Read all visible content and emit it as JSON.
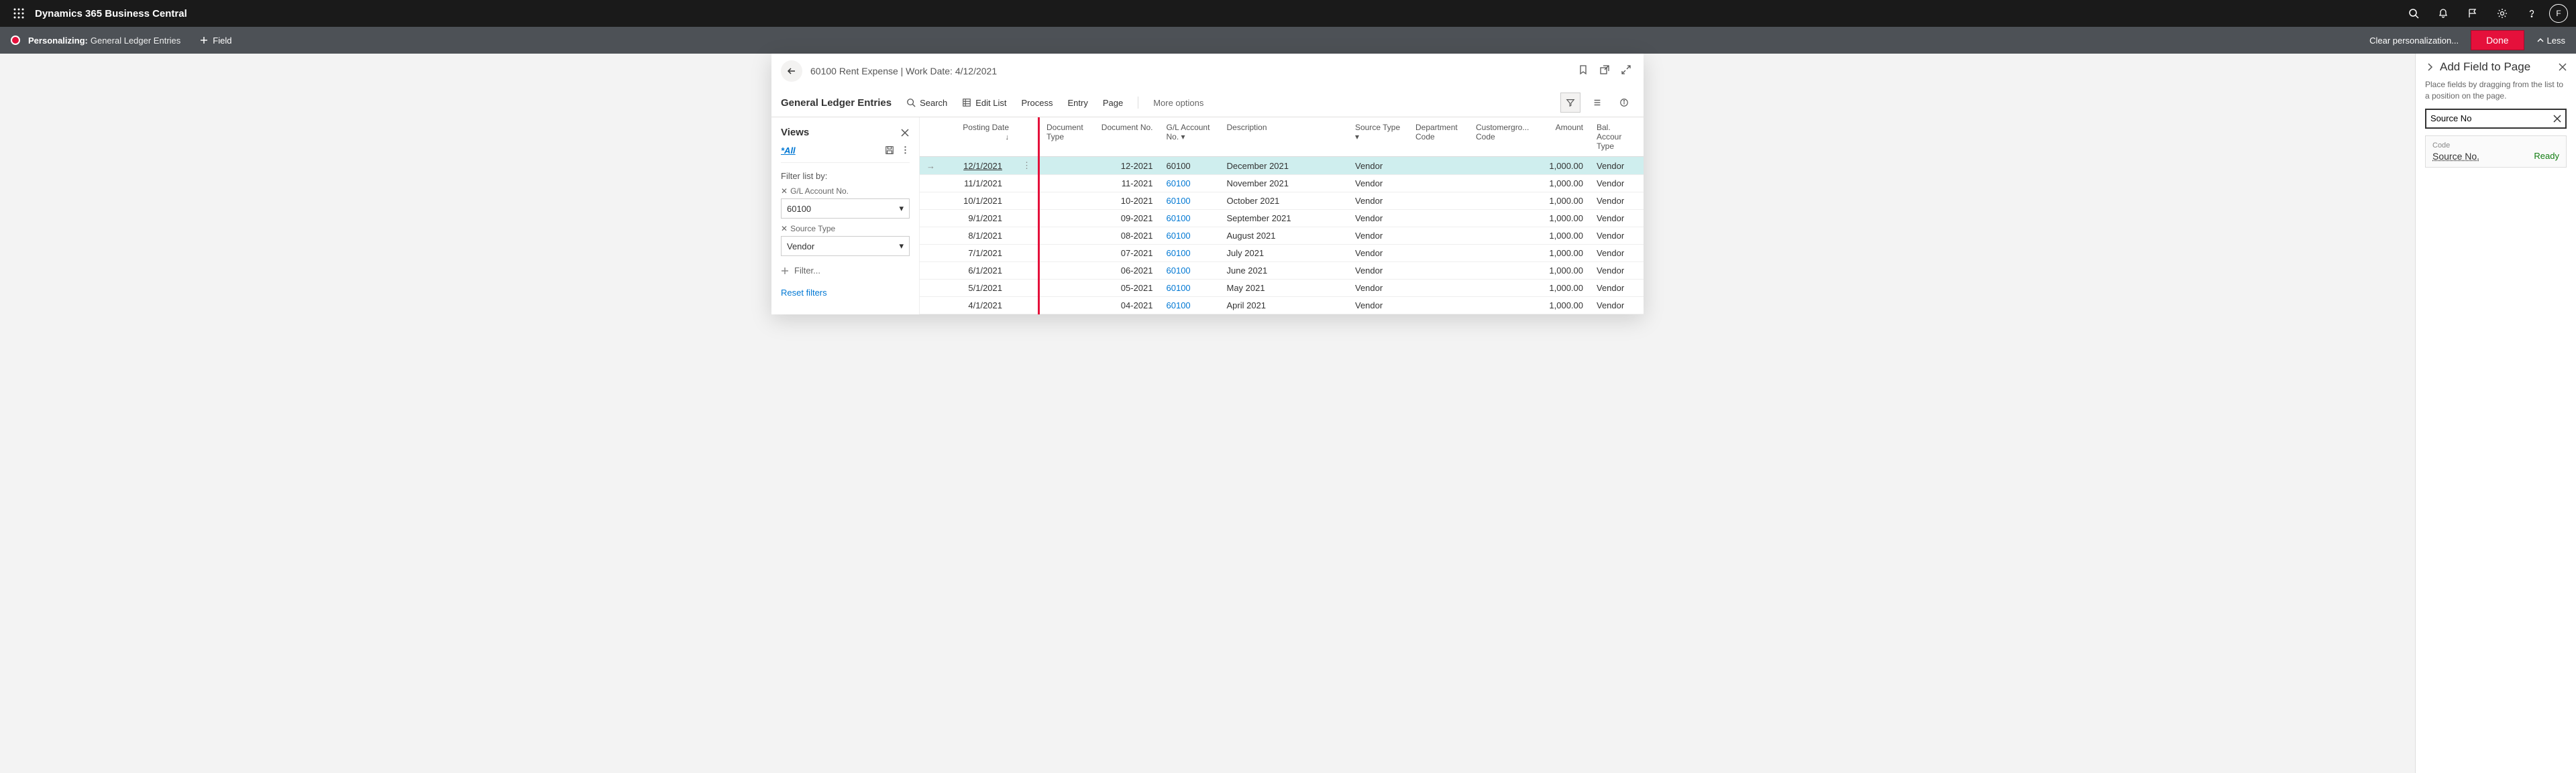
{
  "header": {
    "app_title": "Dynamics 365 Business Central",
    "avatar_initial": "F"
  },
  "personalize": {
    "label": "Personalizing:",
    "sub": "General Ledger Entries",
    "add_field": "Field",
    "clear": "Clear personalization...",
    "done": "Done",
    "less": "Less"
  },
  "card": {
    "breadcrumb": "60100 Rent Expense | Work Date: 4/12/2021",
    "title": "General Ledger Entries"
  },
  "actions": {
    "search": "Search",
    "edit_list": "Edit List",
    "process": "Process",
    "entry": "Entry",
    "page": "Page",
    "more": "More options"
  },
  "views": {
    "title": "Views",
    "all": "*All",
    "filter_list_by": "Filter list by:",
    "f1_label": "G/L Account No.",
    "f1_value": "60100",
    "f2_label": "Source Type",
    "f2_value": "Vendor",
    "add_filter": "Filter...",
    "reset": "Reset filters"
  },
  "columns": {
    "posting_date": "Posting Date",
    "doc_type": "Document Type",
    "doc_no": "Document No.",
    "gl_account": "G/L Account No.",
    "description": "Description",
    "source_type": "Source Type",
    "dept": "Department Code",
    "custgrp": "Customergro... Code",
    "amount": "Amount",
    "bal_account": "Bal. Accour Type"
  },
  "rows": [
    {
      "date": "12/1/2021",
      "docno": "12-2021",
      "gl": "60100",
      "desc": "December 2021",
      "src": "Vendor",
      "amt": "1,000.00",
      "bal": "Vendor"
    },
    {
      "date": "11/1/2021",
      "docno": "11-2021",
      "gl": "60100",
      "desc": "November 2021",
      "src": "Vendor",
      "amt": "1,000.00",
      "bal": "Vendor"
    },
    {
      "date": "10/1/2021",
      "docno": "10-2021",
      "gl": "60100",
      "desc": "October 2021",
      "src": "Vendor",
      "amt": "1,000.00",
      "bal": "Vendor"
    },
    {
      "date": "9/1/2021",
      "docno": "09-2021",
      "gl": "60100",
      "desc": "September 2021",
      "src": "Vendor",
      "amt": "1,000.00",
      "bal": "Vendor"
    },
    {
      "date": "8/1/2021",
      "docno": "08-2021",
      "gl": "60100",
      "desc": "August 2021",
      "src": "Vendor",
      "amt": "1,000.00",
      "bal": "Vendor"
    },
    {
      "date": "7/1/2021",
      "docno": "07-2021",
      "gl": "60100",
      "desc": "July 2021",
      "src": "Vendor",
      "amt": "1,000.00",
      "bal": "Vendor"
    },
    {
      "date": "6/1/2021",
      "docno": "06-2021",
      "gl": "60100",
      "desc": "June 2021",
      "src": "Vendor",
      "amt": "1,000.00",
      "bal": "Vendor"
    },
    {
      "date": "5/1/2021",
      "docno": "05-2021",
      "gl": "60100",
      "desc": "May 2021",
      "src": "Vendor",
      "amt": "1,000.00",
      "bal": "Vendor"
    },
    {
      "date": "4/1/2021",
      "docno": "04-2021",
      "gl": "60100",
      "desc": "April 2021",
      "src": "Vendor",
      "amt": "1,000.00",
      "bal": "Vendor"
    }
  ],
  "side": {
    "title": "Add Field to Page",
    "desc": "Place fields by dragging from the list to a position on the page.",
    "search_value": "Source No",
    "result_group": "Code",
    "result_name": "Source No.",
    "result_status": "Ready"
  }
}
